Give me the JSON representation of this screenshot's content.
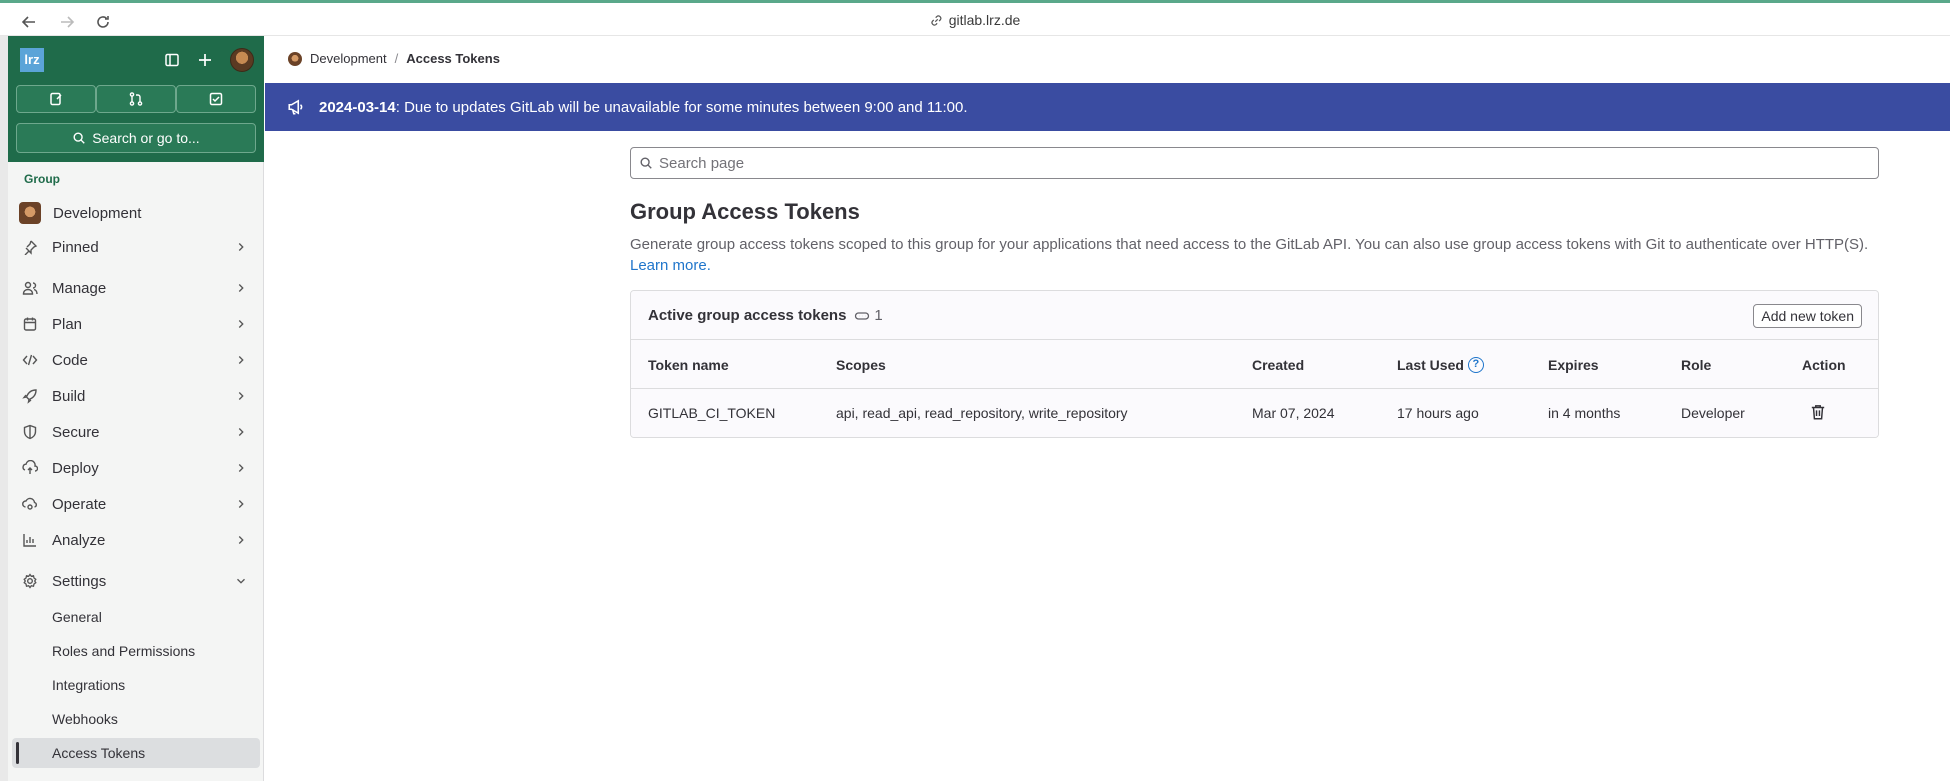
{
  "browser": {
    "url": "gitlab.lrz.de"
  },
  "sidebar": {
    "logo_text": "lrz",
    "search_label": "Search or go to...",
    "section_label": "Group",
    "group_name": "Development",
    "items": [
      {
        "label": "Pinned"
      },
      {
        "label": "Manage"
      },
      {
        "label": "Plan"
      },
      {
        "label": "Code"
      },
      {
        "label": "Build"
      },
      {
        "label": "Secure"
      },
      {
        "label": "Deploy"
      },
      {
        "label": "Operate"
      },
      {
        "label": "Analyze"
      },
      {
        "label": "Settings"
      }
    ],
    "settings_sub": [
      {
        "label": "General"
      },
      {
        "label": "Roles and Permissions"
      },
      {
        "label": "Integrations"
      },
      {
        "label": "Webhooks"
      },
      {
        "label": "Access Tokens"
      }
    ]
  },
  "breadcrumb": {
    "parent": "Development",
    "separator": "/",
    "current": "Access Tokens"
  },
  "banner": {
    "date": "2024-03-14",
    "message": ": Due to updates GitLab will be unavailable for some minutes between 9:00 and 11:00."
  },
  "search": {
    "placeholder": "Search page"
  },
  "page": {
    "title": "Group Access Tokens",
    "description": "Generate group access tokens scoped to this group for your applications that need access to the GitLab API. You can also use group access tokens with Git to authenticate over HTTP(S).",
    "learn_more": "Learn more."
  },
  "tokens": {
    "title": "Active group access tokens",
    "count": "1",
    "add_button": "Add new token",
    "columns": {
      "name": "Token name",
      "scopes": "Scopes",
      "created": "Created",
      "last_used": "Last Used",
      "expires": "Expires",
      "role": "Role",
      "action": "Action"
    },
    "rows": [
      {
        "name": "GITLAB_CI_TOKEN",
        "scopes": "api, read_api, read_repository, write_repository",
        "created": "Mar 07, 2024",
        "last_used": "17 hours ago",
        "expires": "in 4 months",
        "role": "Developer"
      }
    ]
  },
  "colors": {
    "sidebar_header": "#1f6b4a",
    "banner": "#3a4ca1",
    "link": "#1f75cb"
  }
}
